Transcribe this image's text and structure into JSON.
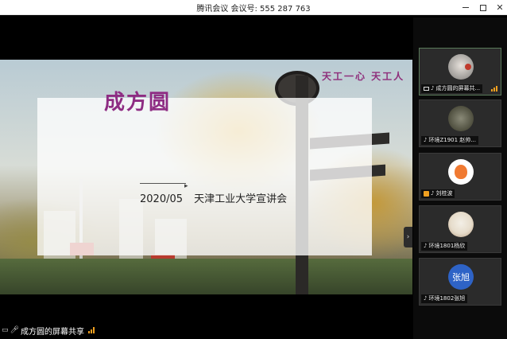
{
  "window": {
    "title": "腾讯会议 会议号: 555 287 763",
    "controls": {
      "minimize_icon": "minimize-icon",
      "maximize_icon": "maximize-icon",
      "close_icon": "close-icon"
    }
  },
  "slide": {
    "banner_text": "天工一心 天工人",
    "title": "成方圆",
    "date": "2020/05",
    "subtitle": "天津工业大学宣讲会"
  },
  "bottom_bar": {
    "sharing_text": "成方圆的屏幕共享"
  },
  "participants": [
    {
      "label": "成方圆的屏幕共...",
      "icon": "screen-share-icon",
      "active": true
    },
    {
      "label": "环境Z1901 赵帅...",
      "icon": "mic-icon",
      "active": false
    },
    {
      "label": "刘桂波",
      "icon": "mic-icon",
      "active": false
    },
    {
      "label": "环境1801杨欣",
      "icon": "mic-icon",
      "active": false
    },
    {
      "label": "环境1802张旭",
      "icon": "mic-icon",
      "avatar_text": "张旭",
      "active": false
    }
  ],
  "colors": {
    "accent_purple": "#8e2c83",
    "signal": "#f0a020",
    "avatar_blue": "#2e63c6"
  }
}
